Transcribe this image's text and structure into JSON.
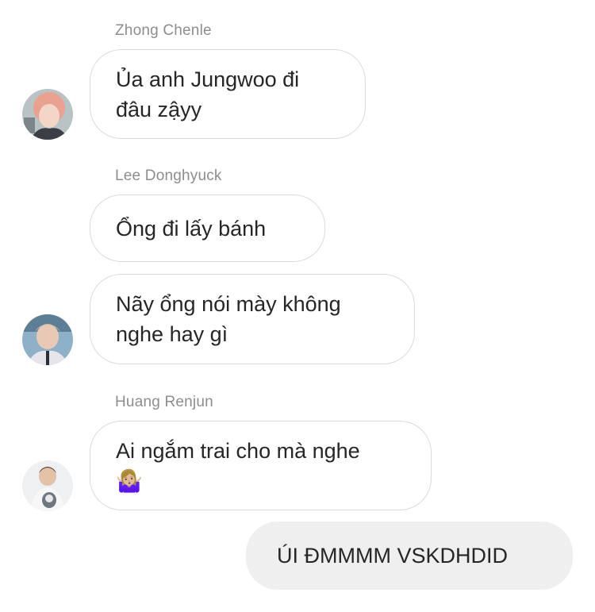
{
  "conversation": [
    {
      "sender": "Zhong Chenle",
      "messages": [
        {
          "lines": [
            "Ủa anh Jungwoo đi",
            "đâu zậyy"
          ]
        }
      ]
    },
    {
      "sender": "Lee Donghyuck",
      "messages": [
        {
          "lines": [
            "Ổng đi lấy bánh"
          ]
        },
        {
          "lines": [
            "Nãy ổng nói mày không",
            "nghe hay gì"
          ]
        }
      ]
    },
    {
      "sender": "Huang Renjun",
      "messages": [
        {
          "lines": [
            "Ai ngắm trai cho mà nghe",
            "🤷🏼‍♀️"
          ]
        }
      ]
    }
  ],
  "my_message": {
    "text": "ÚI ĐMMMM VSKDHDID"
  },
  "colors": {
    "incoming_border": "#dbdbdb",
    "outgoing_bg": "#efefef",
    "sender_name": "#8e8e8e",
    "text": "#262626"
  }
}
